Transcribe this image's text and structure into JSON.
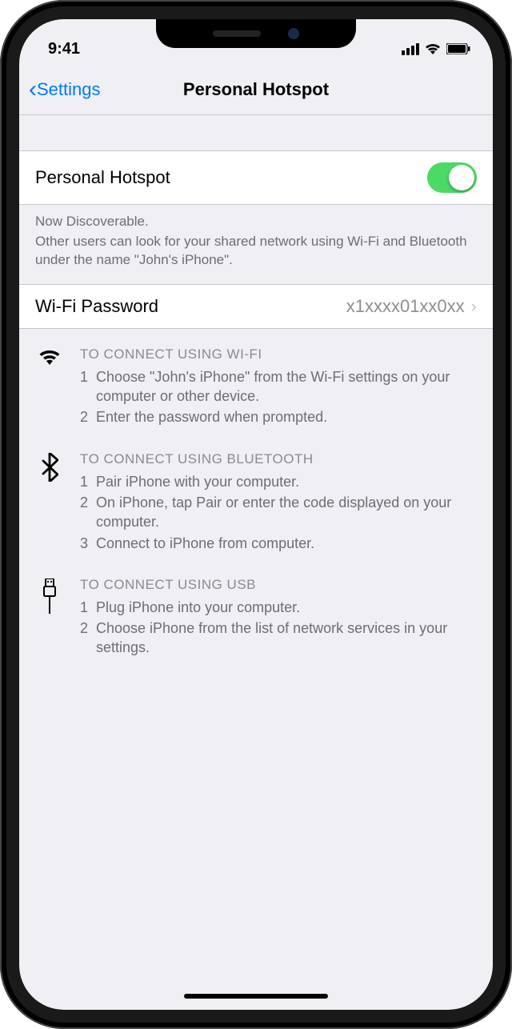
{
  "status": {
    "time": "9:41"
  },
  "nav": {
    "back": "Settings",
    "title": "Personal Hotspot"
  },
  "toggle_row": {
    "label": "Personal Hotspot",
    "on": true
  },
  "discoverable": {
    "line1": "Now Discoverable.",
    "line2": "Other users can look for your shared network using Wi-Fi and Bluetooth under the name \"John's iPhone\"."
  },
  "password_row": {
    "label": "Wi-Fi Password",
    "value": "x1xxxx01xx0xx"
  },
  "sections": {
    "wifi": {
      "header": "TO CONNECT USING WI-FI",
      "s1n": "1",
      "s1t": "Choose \"John's iPhone\" from the Wi-Fi settings on your computer or other device.",
      "s2n": "2",
      "s2t": "Enter the password when prompted."
    },
    "bt": {
      "header": "TO CONNECT USING BLUETOOTH",
      "s1n": "1",
      "s1t": "Pair iPhone with your computer.",
      "s2n": "2",
      "s2t": "On iPhone, tap Pair or enter the code displayed on your computer.",
      "s3n": "3",
      "s3t": "Connect to iPhone from computer."
    },
    "usb": {
      "header": "TO CONNECT USING USB",
      "s1n": "1",
      "s1t": "Plug iPhone into your computer.",
      "s2n": "2",
      "s2t": "Choose iPhone from the list of network services in your settings."
    }
  }
}
